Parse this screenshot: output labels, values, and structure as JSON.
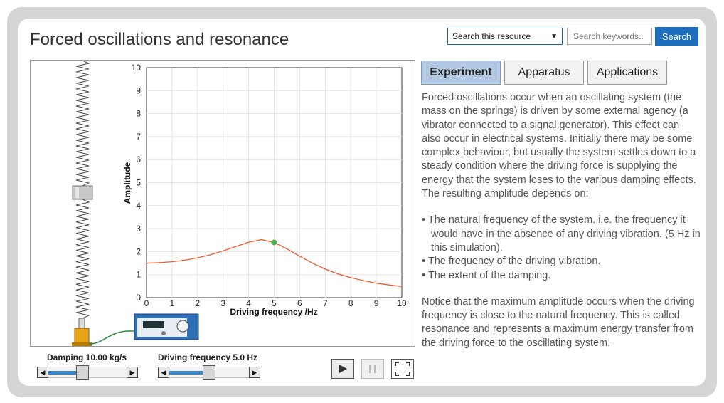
{
  "page": {
    "title": "Forced oscillations and resonance"
  },
  "search": {
    "scope_selected": "Search this resource",
    "placeholder": "Search keywords..",
    "button_label": "Search"
  },
  "tabs": [
    {
      "label": "Experiment",
      "active": true
    },
    {
      "label": "Apparatus",
      "active": false
    },
    {
      "label": "Applications",
      "active": false
    }
  ],
  "controls": {
    "damping_label": "Damping 10.00 kg/s",
    "damping_value_fraction": 0.42,
    "frequency_label": "Driving frequency 5.0 Hz",
    "frequency_value_fraction": 0.5
  },
  "description": {
    "intro": "Forced oscillations occur when an oscillating system (the mass on the springs) is driven by some external agency (a vibrator connected to a signal generator). This effect can also occur in electrical systems. Initially there may be some complex behaviour, but usually the system settles down to a steady condition where the driving force is supplying the energy that the system loses to the various damping effects. The resulting amplitude depends on:",
    "bullets": [
      "• The natural frequency of the system. i.e. the frequency it would have in the absence of any driving vibration. (5 Hz in this simulation).",
      "• The frequency of the driving vibration.",
      "• The extent of the damping."
    ],
    "conclusion": "Notice that the maximum amplitude occurs when the driving frequency is close to the natural frequency. This is called resonance and represents a maximum energy transfer from the driving force to the oscillating system."
  },
  "chart_data": {
    "type": "line",
    "title": "",
    "xlabel": "Driving frequency /Hz",
    "ylabel": "Amplitude",
    "xlim": [
      0,
      10
    ],
    "ylim": [
      0,
      10
    ],
    "xticks": [
      "0",
      "1",
      "2",
      "3",
      "4",
      "5",
      "6",
      "7",
      "8",
      "9",
      "10"
    ],
    "yticks": [
      "0",
      "1",
      "2",
      "3",
      "4",
      "5",
      "6",
      "7",
      "8",
      "9",
      "10"
    ],
    "grid": true,
    "series": [
      {
        "color": "#ee5a2c",
        "x": [
          0,
          0.5,
          1,
          1.5,
          2,
          2.5,
          3,
          3.5,
          4,
          4.5,
          5,
          5.5,
          6,
          6.5,
          7,
          7.5,
          8,
          8.5,
          9,
          9.5,
          10
        ],
        "y": [
          1.5,
          1.52,
          1.56,
          1.63,
          1.73,
          1.86,
          2.03,
          2.22,
          2.41,
          2.52,
          2.4,
          2.12,
          1.8,
          1.5,
          1.24,
          1.03,
          0.87,
          0.74,
          0.63,
          0.55,
          0.48
        ]
      }
    ],
    "marker": {
      "x": 5.0,
      "y": 2.4,
      "color": "#4caf50"
    }
  },
  "colors": {
    "accent": "#1d6fbd",
    "tab_active": "#b3c9e3"
  }
}
